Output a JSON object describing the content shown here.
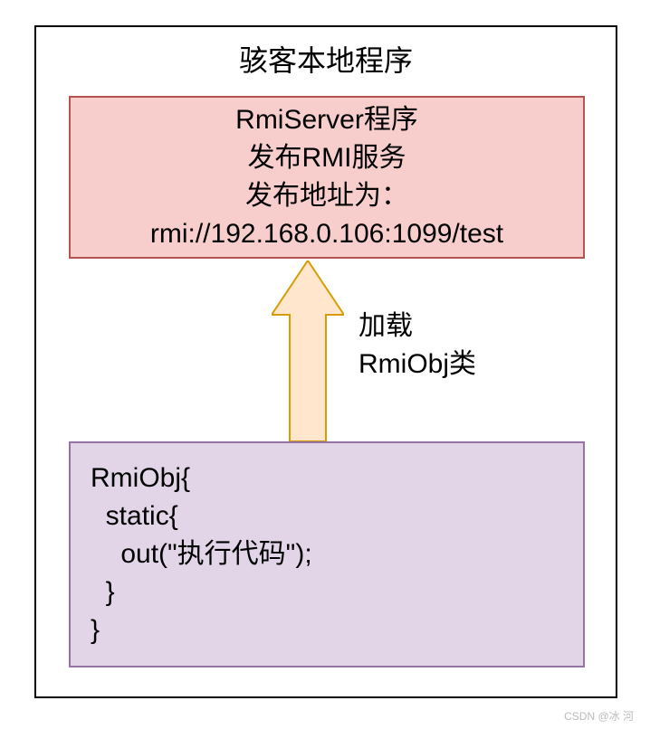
{
  "diagram": {
    "title": "骇客本地程序",
    "server_box": {
      "line1": "RmiServer程序",
      "line2": "发布RMI服务",
      "line3": "发布地址为：",
      "line4": "rmi://192.168.0.106:1099/test"
    },
    "arrow": {
      "label_line1": "加载",
      "label_line2": "RmiObj类",
      "fill": "#ffe6cc",
      "stroke": "#d79b00"
    },
    "code_box": {
      "content": "RmiObj{\n  static{\n    out(\"执行代码\");\n  }\n}"
    },
    "watermark": "CSDN @冰 河"
  }
}
